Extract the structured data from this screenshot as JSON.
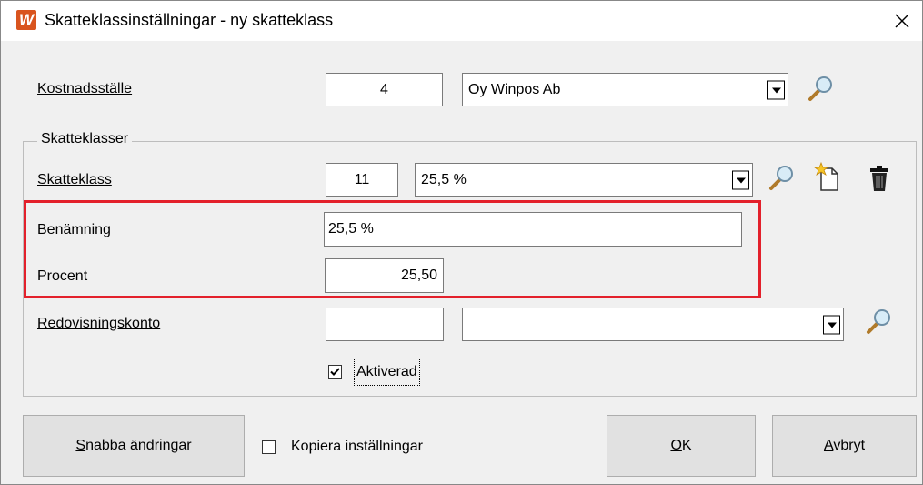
{
  "window": {
    "title": "Skatteklassinställningar - ny skatteklass",
    "app_icon_letter": "W",
    "close_symbol": "✕"
  },
  "cost_center": {
    "label": "Kostnadsställe",
    "code": "4",
    "name": "Oy Winpos Ab"
  },
  "group": {
    "title": "Skatteklasser"
  },
  "tax_class": {
    "label": "Skatteklass",
    "code": "11",
    "name": "25,5 %"
  },
  "description": {
    "label": "Benämning",
    "value": "25,5 %"
  },
  "percent": {
    "label": "Procent",
    "value": "25,50"
  },
  "account": {
    "label": "Redovisningskonto",
    "code": "",
    "name": ""
  },
  "activated": {
    "label": "Aktiverad",
    "checked": true
  },
  "buttons": {
    "quick_changes_prefix": "S",
    "quick_changes_rest": "nabba ändringar",
    "copy_settings": "Kopiera inställningar",
    "ok_prefix": "O",
    "ok_rest": "K",
    "cancel_prefix": "A",
    "cancel_rest": "vbryt"
  },
  "colors": {
    "highlight": "#e3202b",
    "app_icon": "#d9541e"
  }
}
